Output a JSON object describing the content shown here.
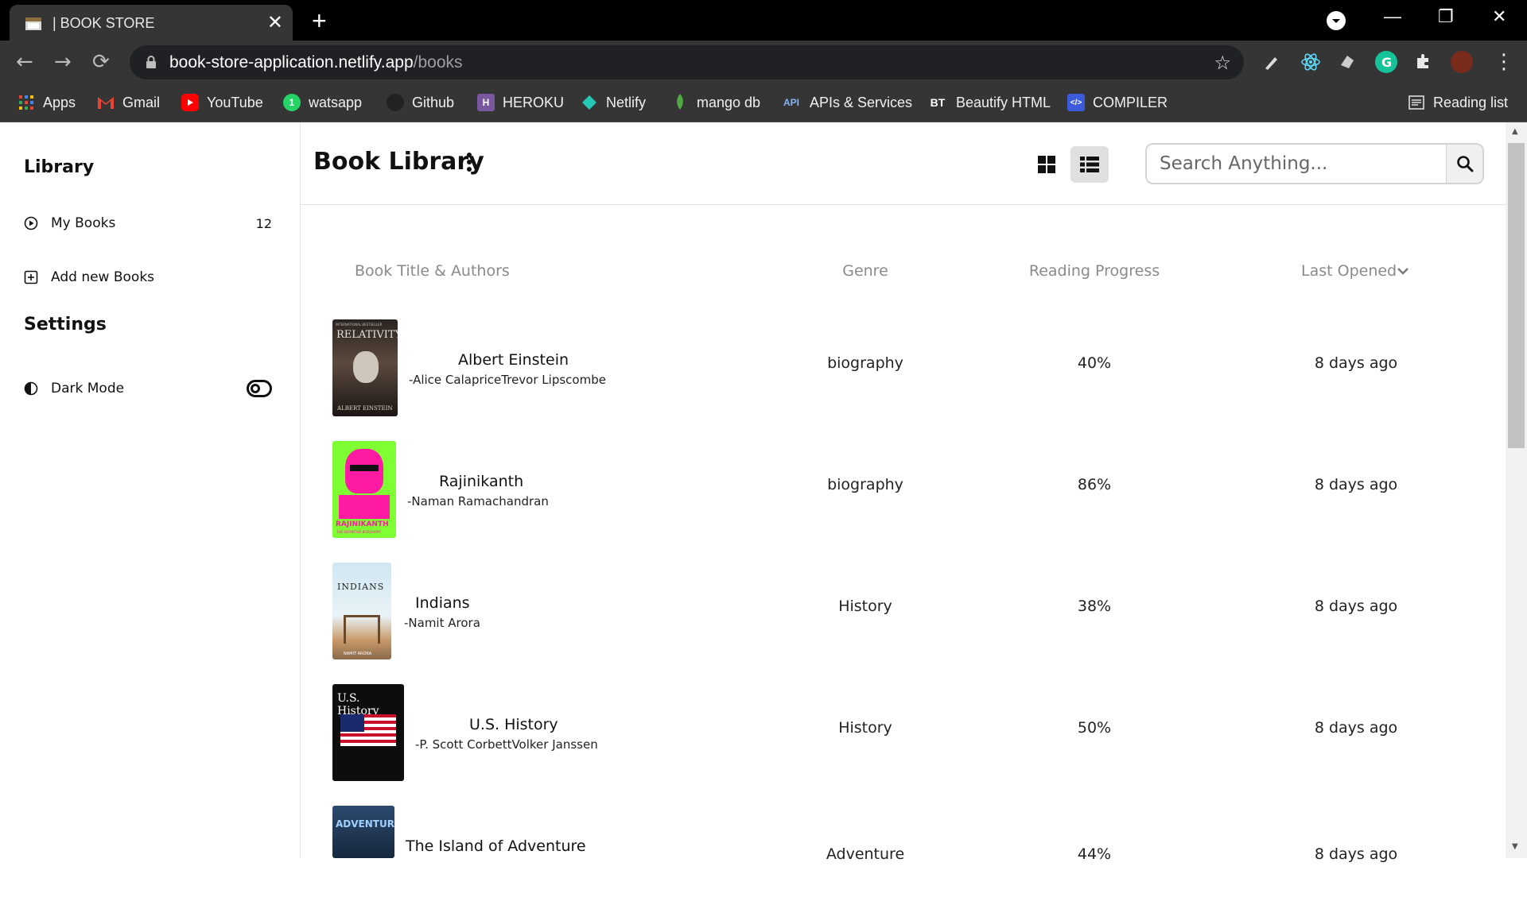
{
  "browser": {
    "tab_title": "| BOOK STORE",
    "new_tab_label": "+",
    "url_domain": "book-store-application.netlify.app",
    "url_path": "/books",
    "bookmarks": [
      {
        "label": "Apps",
        "icon": "apps-grid-icon"
      },
      {
        "label": "Gmail",
        "icon": "gmail-icon"
      },
      {
        "label": "YouTube",
        "icon": "youtube-icon"
      },
      {
        "label": "watsapp",
        "icon": "whatsapp-icon"
      },
      {
        "label": "Github",
        "icon": "github-icon"
      },
      {
        "label": "HEROKU",
        "icon": "heroku-icon"
      },
      {
        "label": "Netlify",
        "icon": "netlify-icon"
      },
      {
        "label": "mango db",
        "icon": "mongodb-leaf-icon"
      },
      {
        "label": "APIs & Services",
        "icon": "api-icon"
      },
      {
        "label": "Beautify HTML",
        "icon": "beautify-icon"
      },
      {
        "label": "COMPILER",
        "icon": "code-icon"
      }
    ],
    "reading_list_label": "Reading list"
  },
  "sidebar": {
    "library_heading": "Library",
    "my_books_label": "My Books",
    "my_books_count": "12",
    "add_books_label": "Add new Books",
    "settings_heading": "Settings",
    "dark_mode_label": "Dark Mode"
  },
  "header": {
    "title": "Book Library",
    "search_placeholder": "Search Anything..."
  },
  "table": {
    "columns": {
      "title": "Book Title & Authors",
      "genre": "Genre",
      "progress": "Reading Progress",
      "last_opened": "Last Opened"
    },
    "rows": [
      {
        "title": "Albert Einstein",
        "authors": "-Alice CalapriceTrevor Lipscombe",
        "genre": "biography",
        "progress": "40%",
        "last_opened": "8 days ago",
        "cover_top": "INTERNATIONAL BESTSELLER",
        "cover_main": "RELATIVITY",
        "cover_bottom": "ALBERT EINSTEIN"
      },
      {
        "title": "Rajinikanth",
        "authors": "-Naman Ramachandran",
        "genre": "biography",
        "progress": "86%",
        "last_opened": "8 days ago",
        "cover_main": "RAJINIKANTH",
        "cover_bottom": "THE DEFINITIVE BIOGRAPHY"
      },
      {
        "title": "Indians",
        "authors": "-Namit Arora",
        "genre": "History",
        "progress": "38%",
        "last_opened": "8 days ago",
        "cover_main": "INDIANS",
        "cover_bottom": "NAMIT ARORA"
      },
      {
        "title": "U.S. History",
        "authors": "-P. Scott CorbettVolker Janssen",
        "genre": "History",
        "progress": "50%",
        "last_opened": "8 days ago",
        "cover_main": "U.S. History"
      },
      {
        "title": "The Island of Adventure",
        "authors": "",
        "genre": "Adventure",
        "progress": "44%",
        "last_opened": "8 days ago",
        "cover_main": "ADVENTURE"
      }
    ]
  },
  "colors": {
    "accent_dark": "#111111",
    "header_border": "#e2e2e2",
    "active_view_bg": "#e0e0e0"
  }
}
